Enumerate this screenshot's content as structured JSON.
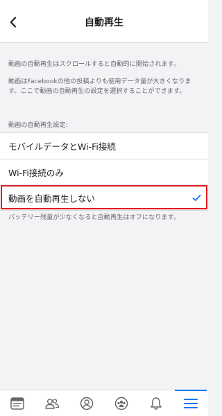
{
  "header": {
    "title": "自動再生",
    "back_icon": "chevron-left-icon"
  },
  "description": {
    "line1": "動画の自動再生はスクロールすると自動的に開始されます。",
    "line2": "動画はFacebookの他の投稿よりも使用データ量が大きくなります。ここで動画の自動再生の設定を選択することができます。"
  },
  "section_label": "動画の自動再生設定:",
  "options": [
    {
      "label": "モバイルデータとWi-Fi接続",
      "selected": false
    },
    {
      "label": "Wi-Fi接続のみ",
      "selected": false
    },
    {
      "label": "動画を自動再生しない",
      "selected": true
    }
  ],
  "check_icon": "checkmark-icon",
  "footnote": "バッテリー残量が少なくなると自動再生はオフになります。",
  "tabbar": {
    "tabs": [
      {
        "icon": "news-feed-icon",
        "active": false
      },
      {
        "icon": "friends-icon",
        "active": false
      },
      {
        "icon": "profile-icon",
        "active": false
      },
      {
        "icon": "groups-icon",
        "active": false
      },
      {
        "icon": "notifications-bell-icon",
        "active": false
      },
      {
        "icon": "menu-icon",
        "active": true
      }
    ]
  },
  "colors": {
    "accent": "#1877f2",
    "selection_outline": "#e01a22",
    "secondary_text": "#65676b",
    "background": "#f2f3f5"
  }
}
